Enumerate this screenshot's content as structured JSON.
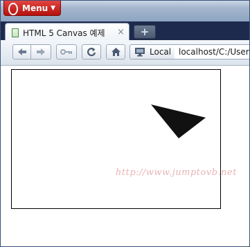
{
  "menu": {
    "label": "Menu"
  },
  "tab": {
    "title": "HTML 5 Canvas 예제",
    "close": "×"
  },
  "new_tab": {
    "symbol": "+"
  },
  "address": {
    "site_label": "Local",
    "url": "localhost/C:/Users/"
  },
  "watermark": "http://www.jumptovb.net",
  "colors": {
    "menu_red": "#c9211c",
    "triangle": "#111111",
    "watermark": "#e8b3b3"
  }
}
